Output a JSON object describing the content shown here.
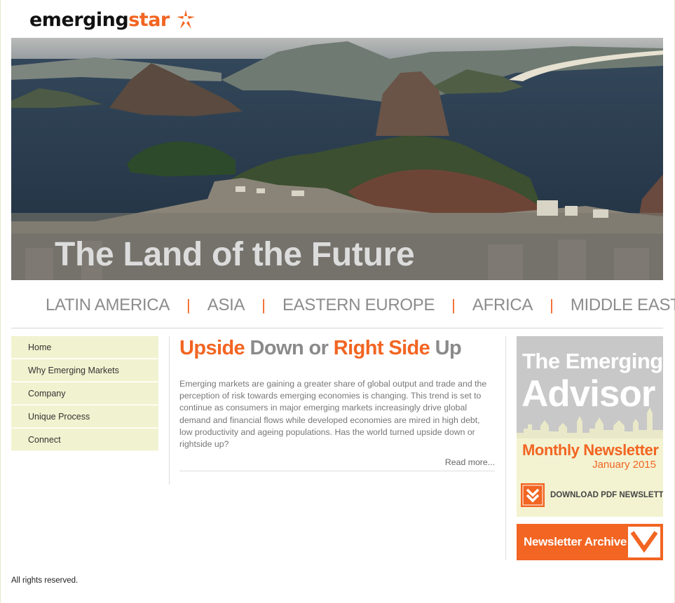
{
  "logo": {
    "word1": "emerging",
    "word2": "star"
  },
  "hero": {
    "tagline": "The Land of the Future"
  },
  "regions": [
    "LATIN AMERICA",
    "ASIA",
    "EASTERN EUROPE",
    "AFRICA",
    "MIDDLE EAST"
  ],
  "region_separator": "|",
  "sidebar": {
    "items": [
      {
        "label": "Home"
      },
      {
        "label": "Why Emerging Markets"
      },
      {
        "label": "Company"
      },
      {
        "label": "Unique Process"
      },
      {
        "label": "Connect"
      }
    ]
  },
  "article": {
    "title_parts": [
      "Upside",
      " Down or ",
      "Right Side",
      " Up"
    ],
    "body": "Emerging markets are gaining a greater share of global output and trade and the perception of risk towards emerging economies is changing. This trend is set to continue as consumers in major emerging markets increasingly drive global demand and financial flows while developed economies are mired in high debt, low productivity and ageing populations. Has the world turned upside down or rightside up?",
    "read_more": "Read more..."
  },
  "advisor": {
    "line1": "The Emerging",
    "line2": "Advisor",
    "newsletter": "Monthly Newsletter",
    "date": "January 2015",
    "download": "DOWNLOAD PDF NEWSLETTER"
  },
  "archive": {
    "label": "Newsletter Archive"
  },
  "footer": {
    "text": "All rights reserved."
  },
  "colors": {
    "accent": "#f26522",
    "nav_bg": "#f1f2cf",
    "text_gray": "#8a8a8a"
  }
}
